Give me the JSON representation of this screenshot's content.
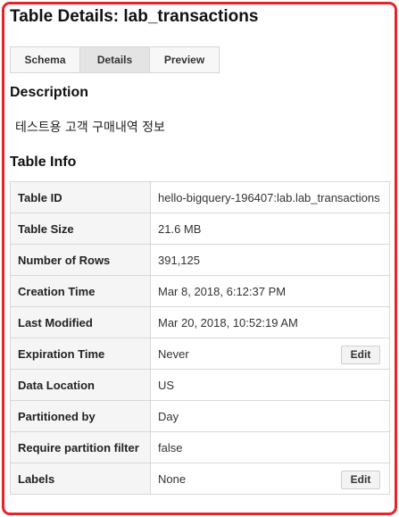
{
  "page": {
    "title": "Table Details: lab_transactions"
  },
  "tabs": [
    {
      "label": "Schema",
      "active": false
    },
    {
      "label": "Details",
      "active": true
    },
    {
      "label": "Preview",
      "active": false
    }
  ],
  "description": {
    "heading": "Description",
    "text": "테스트용 고객 구매내역 정보"
  },
  "table_info": {
    "heading": "Table Info",
    "rows": [
      {
        "key": "Table ID",
        "value": "hello-bigquery-196407:lab.lab_transactions"
      },
      {
        "key": "Table Size",
        "value": "21.6 MB"
      },
      {
        "key": "Number of Rows",
        "value": "391,125"
      },
      {
        "key": "Creation Time",
        "value": "Mar 8, 2018, 6:12:37 PM"
      },
      {
        "key": "Last Modified",
        "value": "Mar 20, 2018, 10:52:19 AM"
      },
      {
        "key": "Expiration Time",
        "value": "Never",
        "edit_label": "Edit"
      },
      {
        "key": "Data Location",
        "value": "US"
      },
      {
        "key": "Partitioned by",
        "value": "Day"
      },
      {
        "key": "Require partition filter",
        "value": "false"
      },
      {
        "key": "Labels",
        "value": "None",
        "edit_label": "Edit"
      }
    ]
  },
  "colors": {
    "frame_border": "#e8242b",
    "active_tab": "#e4e4e4",
    "key_cell_bg": "#f5f5f5"
  }
}
